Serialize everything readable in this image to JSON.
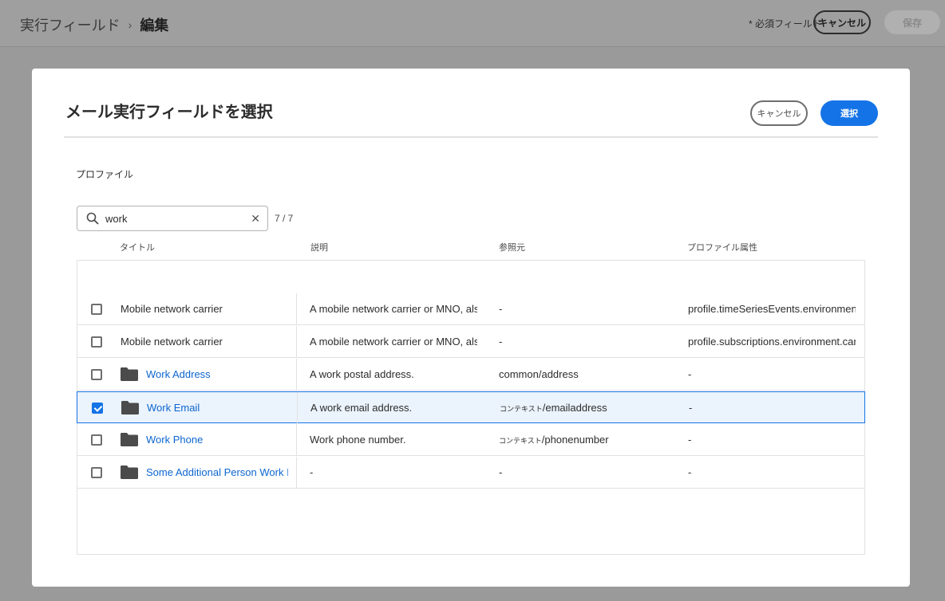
{
  "topbar": {
    "breadcrumb_parent": "実行フィールド",
    "breadcrumb_separator": "›",
    "breadcrumb_current": "編集",
    "required_note": "* 必須フィールド",
    "cancel_label": "キャンセル",
    "save_label": "保存"
  },
  "dialog": {
    "title": "メール実行フィールドを選択",
    "cancel_label": "キャンセル",
    "select_label": "選択",
    "section_label": "プロファイル",
    "search": {
      "value": "work"
    },
    "count": "7 / 7",
    "columns": [
      "タイトル",
      "説明",
      "参照元",
      "プロファイル属性"
    ],
    "rows": [
      {
        "title": "Mobile network carrier",
        "desc": "A mobile network carrier or MNO, als",
        "ref_prefix": "",
        "ref": "-",
        "attr": "profile.timeSeriesEvents.environment"
      },
      {
        "title": "Mobile network carrier",
        "desc": "A mobile network carrier or MNO, als",
        "ref_prefix": "",
        "ref": "-",
        "attr": "profile.subscriptions.environment.car"
      },
      {
        "title": "Work Address",
        "desc": "A work postal address.",
        "ref_prefix": "",
        "ref": "common/address",
        "attr": "-"
      },
      {
        "title": "Work Email",
        "desc": "A work email address.",
        "ref_prefix": "コンテキスト",
        "ref": "/emailaddress",
        "attr": "-"
      },
      {
        "title": "Work Phone",
        "desc": "Work phone number.",
        "ref_prefix": "コンテキスト",
        "ref": "/phonenumber",
        "attr": "-"
      },
      {
        "title": "Some Additional Person Work I",
        "desc": "-",
        "ref_prefix": "",
        "ref": "-",
        "attr": "-"
      }
    ]
  },
  "colors": {
    "accent": "#1473e6",
    "link": "#0d66d0",
    "selected_row": "#ebf3fc"
  }
}
